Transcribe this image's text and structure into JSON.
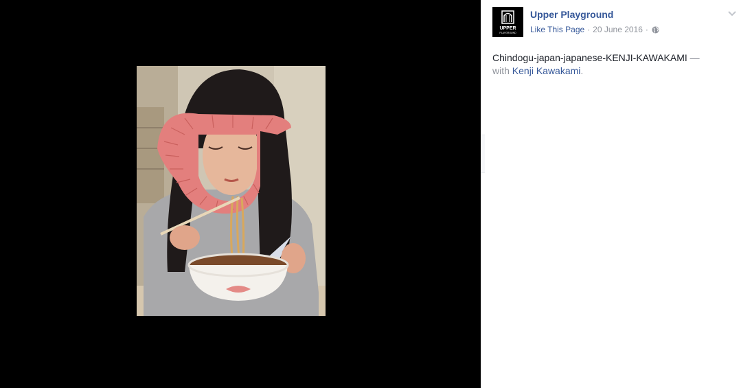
{
  "post": {
    "page_name": "Upper Playground",
    "like_label": "Like This Page",
    "separator": "·",
    "date": "20 June 2016",
    "privacy_icon": "globe-icon",
    "menu_icon": "chevron-down-icon",
    "caption": "Chindogu-japan-japanese-KENJI-KAWAKAMI",
    "caption_dash": "—",
    "with_label": "with",
    "tagged_person": "Kenji Kawakami",
    "period": "."
  },
  "avatar": {
    "logo_text_top": "UPPER",
    "logo_text_bottom": "PLAYGROUND"
  },
  "photo": {
    "description_icon": "photo"
  },
  "colors": {
    "link": "#365899",
    "meta": "#90949c",
    "text": "#1d2129",
    "viewer_bg": "#000000"
  }
}
